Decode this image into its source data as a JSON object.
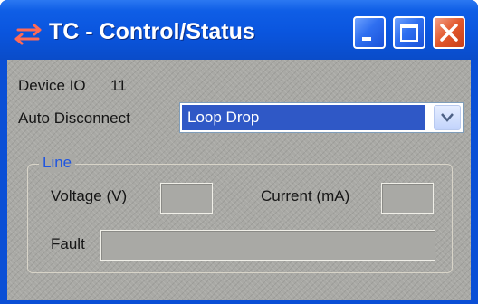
{
  "window": {
    "title": "TC - Control/Status",
    "icon": "transfer-arrows-icon",
    "buttons": {
      "minimize": "minimize-icon",
      "maximize": "maximize-icon",
      "close": "close-icon"
    }
  },
  "device": {
    "label": "Device IO",
    "value": "11"
  },
  "auto_disconnect": {
    "label": "Auto Disconnect",
    "selected": "Loop Drop",
    "arrow_icon": "chevron-down-icon"
  },
  "line": {
    "title": "Line",
    "voltage_label": "Voltage (V)",
    "voltage_value": "",
    "current_label": "Current (mA)",
    "current_value": "",
    "fault_label": "Fault",
    "fault_value": ""
  },
  "colors": {
    "titlebar": "#0a55de",
    "client": "#a9a9a5",
    "selection": "#2f58c6",
    "group_title": "#1f55e0",
    "close_button": "#e2572b"
  }
}
